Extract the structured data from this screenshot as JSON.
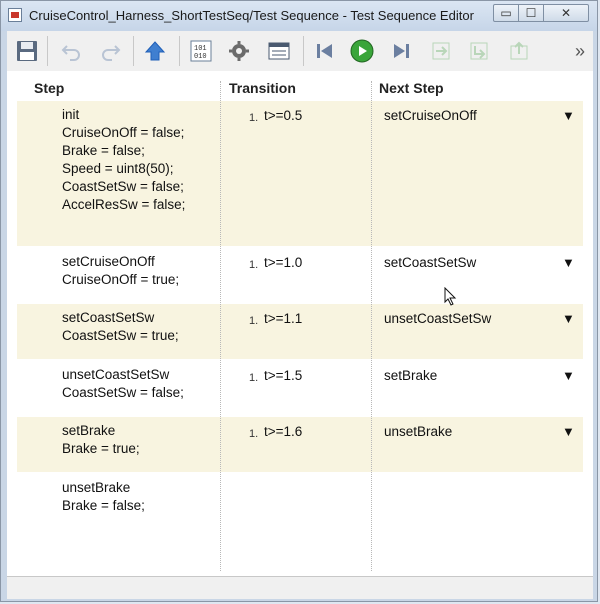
{
  "window": {
    "title": "CruiseControl_Harness_ShortTestSeq/Test Sequence - Test Sequence Editor"
  },
  "controls": {
    "minimize": "▭",
    "maximize": "☐",
    "close": "✕"
  },
  "toolbar": {
    "icons": [
      "save-icon",
      "undo-icon",
      "redo-icon",
      "up-arrow-icon",
      "binary-data-icon",
      "settings-gear-icon",
      "symbols-icon",
      "step-back-icon",
      "run-icon",
      "step-forward-icon",
      "add-step-icon",
      "add-child-step-icon",
      "add-transition-icon"
    ],
    "overflow": "»"
  },
  "headers": {
    "step": "Step",
    "transition": "Transition",
    "next_step": "Next Step"
  },
  "rows": [
    {
      "step": "init\nCruiseOnOff = false;\nBrake = false;\nSpeed = uint8(50);\nCoastSetSw = false;\nAccelResSw = false;",
      "num": "1.",
      "cond": "t>=0.5",
      "next": "setCruiseOnOff",
      "arrow": "▼"
    },
    {
      "step": "setCruiseOnOff\nCruiseOnOff = true;",
      "num": "1.",
      "cond": "t>=1.0",
      "next": "setCoastSetSw",
      "arrow": "▼"
    },
    {
      "step": "setCoastSetSw\nCoastSetSw = true;",
      "num": "1.",
      "cond": "t>=1.1",
      "next": "unsetCoastSetSw",
      "arrow": "▼"
    },
    {
      "step": "unsetCoastSetSw\nCoastSetSw = false;",
      "num": "1.",
      "cond": "t>=1.5",
      "next": "setBrake",
      "arrow": "▼"
    },
    {
      "step": "setBrake\nBrake = true;",
      "num": "1.",
      "cond": "t>=1.6",
      "next": "unsetBrake",
      "arrow": "▼"
    },
    {
      "step": "unsetBrake\nBrake = false;",
      "num": "",
      "cond": "",
      "next": "",
      "arrow": ""
    }
  ],
  "colors": {
    "row_shade": "#f8f4e0",
    "run": "#3aa53a",
    "accent": "#1f5fb8"
  }
}
